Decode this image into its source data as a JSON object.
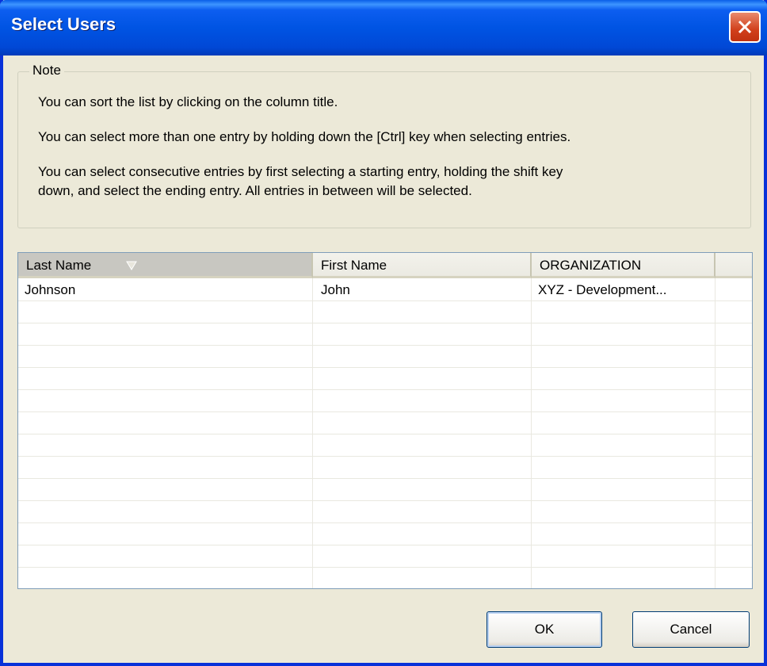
{
  "window": {
    "title": "Select Users"
  },
  "note": {
    "label": "Note",
    "lines": [
      "You can sort the list by clicking on the column title.",
      "You can select more than one entry by holding down the [Ctrl] key when selecting entries.",
      "You can select consecutive entries by first selecting a starting entry, holding the shift key",
      "down, and select the ending entry. All entries in between will be selected."
    ]
  },
  "list": {
    "columns": [
      "Last Name",
      "First Name",
      "ORGANIZATION"
    ],
    "sorted_column": "Last Name",
    "sort_direction": "descending",
    "rows": [
      {
        "last_name": "Johnson",
        "first_name": "John",
        "organization": "XYZ - Development..."
      }
    ]
  },
  "buttons": {
    "ok": "OK",
    "cancel": "Cancel"
  },
  "colors": {
    "title_bar": "#0054e3",
    "close_button": "#d1401c",
    "dialog_bg": "#ece9d8"
  }
}
